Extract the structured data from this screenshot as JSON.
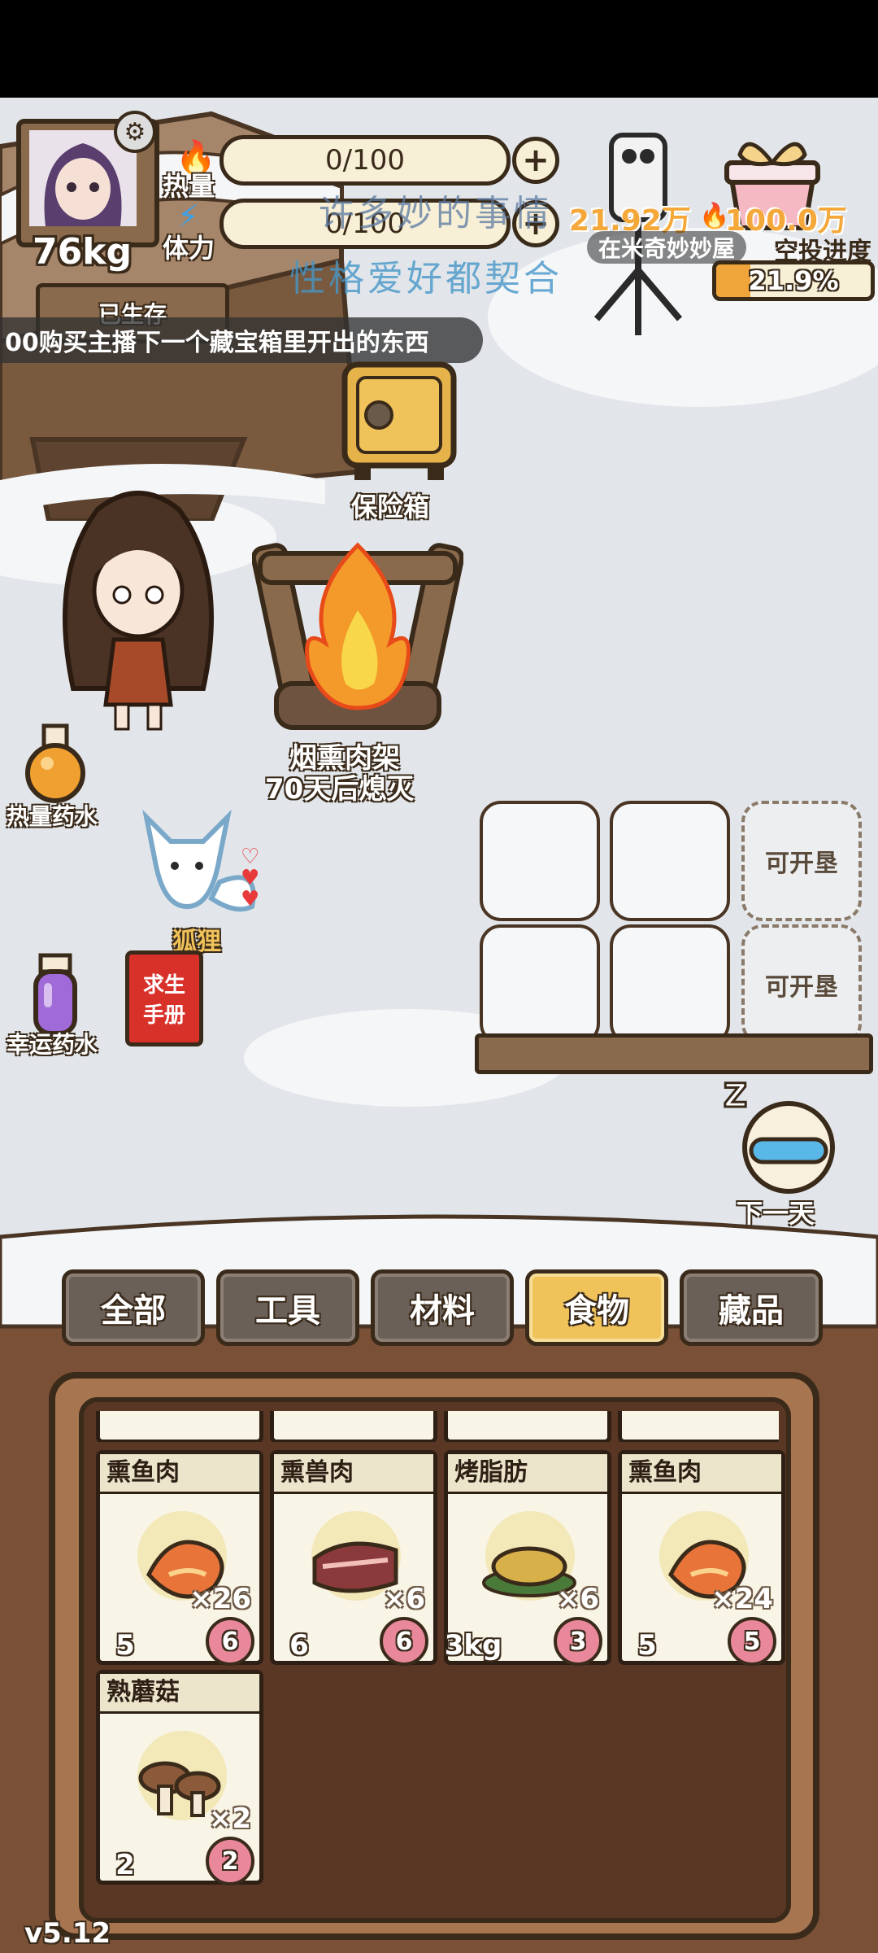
{
  "player": {
    "weight": "76kg",
    "survival_label": "已生存",
    "avatar_caption": ""
  },
  "stats": {
    "calories_label": "热量",
    "calories_value": "0/100",
    "stamina_label": "体力",
    "stamina_value": "0/100"
  },
  "overlay": {
    "watermark_line1": "许多妙的事情",
    "watermark_line2": "性格爱好都契合",
    "stream_stat": "21.92万",
    "stream_stat2": "100.0万",
    "channel_name": "在米奇妙妙屋",
    "airdrop_label": "空投进度",
    "airdrop_percent": "21.9%",
    "airdrop_fraction": 0.219
  },
  "ticker": {
    "text": "00购买主播下一个藏宝箱里开出的东西"
  },
  "scene": {
    "safe_label": "保险箱",
    "smoker_label": "烟熏肉架",
    "smoker_status": "70天后熄灭",
    "calorie_potion": "热量药水",
    "luck_potion": "幸运药水",
    "fox_label": "狐狸",
    "handbook_line1": "求生",
    "handbook_line2": "手册",
    "plot_open_1": "可开垦",
    "plot_open_2": "可开垦",
    "next_day": "下一天"
  },
  "tabs": [
    {
      "label": "全部",
      "active": false
    },
    {
      "label": "工具",
      "active": false
    },
    {
      "label": "材料",
      "active": false
    },
    {
      "label": "食物",
      "active": true
    },
    {
      "label": "藏品",
      "active": false
    }
  ],
  "inventory": {
    "items": [
      {
        "name": "熏鱼肉",
        "qty": "×26",
        "left": "5",
        "right": "6",
        "icon": "fish-icon"
      },
      {
        "name": "熏兽肉",
        "qty": "×6",
        "left": "6",
        "right": "6",
        "icon": "meat-icon"
      },
      {
        "name": "烤脂肪",
        "qty": "×6",
        "left": "3kg",
        "right": "3",
        "icon": "fat-icon"
      },
      {
        "name": "熏鱼肉",
        "qty": "×24",
        "left": "5",
        "right": "5",
        "icon": "fish-icon"
      },
      {
        "name": "熟蘑菇",
        "qty": "×2",
        "left": "2",
        "right": "2",
        "icon": "mushroom-icon"
      }
    ]
  },
  "version": "v5.12"
}
